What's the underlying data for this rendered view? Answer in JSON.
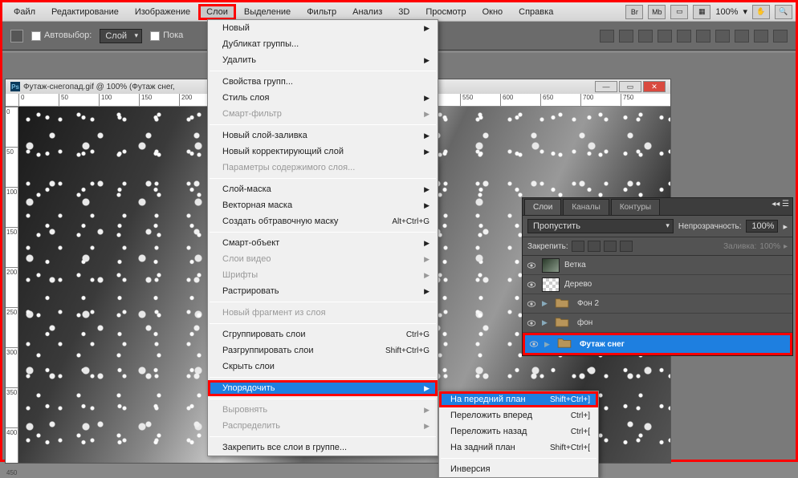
{
  "menubar": {
    "items": [
      "Файл",
      "Редактирование",
      "Изображение",
      "Слои",
      "Выделение",
      "Фильтр",
      "Анализ",
      "3D",
      "Просмотр",
      "Окно",
      "Справка"
    ],
    "highlighted": "Слои",
    "zoom": "100%"
  },
  "optbar": {
    "autoselect_label": "Автовыбор:",
    "autoselect_value": "Слой",
    "show_label": "Пока"
  },
  "doc": {
    "title": "Футаж-снегопад.gif @ 100% (Футаж снег,",
    "ruler_h": [
      "0",
      "50",
      "100",
      "150",
      "200",
      "550",
      "600",
      "650",
      "700",
      "750"
    ],
    "ruler_v": [
      "0",
      "50",
      "100",
      "150",
      "200",
      "250",
      "300",
      "350",
      "400",
      "450"
    ]
  },
  "dropdown": {
    "groups": [
      [
        {
          "label": "Новый",
          "arrow": true
        },
        {
          "label": "Дубликат группы..."
        },
        {
          "label": "Удалить",
          "arrow": true
        }
      ],
      [
        {
          "label": "Свойства групп..."
        },
        {
          "label": "Стиль слоя",
          "arrow": true
        },
        {
          "label": "Смарт-фильтр",
          "arrow": true,
          "disabled": true
        }
      ],
      [
        {
          "label": "Новый слой-заливка",
          "arrow": true
        },
        {
          "label": "Новый корректирующий слой",
          "arrow": true
        },
        {
          "label": "Параметры содержимого слоя...",
          "disabled": true
        }
      ],
      [
        {
          "label": "Слой-маска",
          "arrow": true
        },
        {
          "label": "Векторная маска",
          "arrow": true
        },
        {
          "label": "Создать обтравочную маску",
          "shortcut": "Alt+Ctrl+G"
        }
      ],
      [
        {
          "label": "Смарт-объект",
          "arrow": true
        },
        {
          "label": "Слои видео",
          "arrow": true,
          "disabled": true
        },
        {
          "label": "Шрифты",
          "arrow": true,
          "disabled": true
        },
        {
          "label": "Растрировать",
          "arrow": true
        }
      ],
      [
        {
          "label": "Новый фрагмент из слоя",
          "disabled": true
        }
      ],
      [
        {
          "label": "Сгруппировать слои",
          "shortcut": "Ctrl+G"
        },
        {
          "label": "Разгруппировать слои",
          "shortcut": "Shift+Ctrl+G"
        },
        {
          "label": "Скрыть слои"
        }
      ],
      [
        {
          "label": "Упорядочить",
          "arrow": true,
          "hl": true
        }
      ],
      [
        {
          "label": "Выровнять",
          "arrow": true,
          "disabled": true
        },
        {
          "label": "Распределить",
          "arrow": true,
          "disabled": true
        }
      ],
      [
        {
          "label": "Закрепить все слои в группе..."
        }
      ]
    ]
  },
  "submenu": {
    "items": [
      {
        "label": "На передний план",
        "shortcut": "Shift+Ctrl+]",
        "hl": true
      },
      {
        "label": "Переложить вперед",
        "shortcut": "Ctrl+]"
      },
      {
        "label": "Переложить назад",
        "shortcut": "Ctrl+["
      },
      {
        "label": "На задний план",
        "shortcut": "Shift+Ctrl+["
      }
    ],
    "items2": [
      {
        "label": "Инверсия"
      }
    ]
  },
  "layers_panel": {
    "tabs": [
      "Слои",
      "Каналы",
      "Контуры"
    ],
    "blend_mode": "Пропустить",
    "opacity_label": "Непрозрачность:",
    "opacity_value": "100%",
    "lock_label": "Закрепить:",
    "fill_label": "Заливка:",
    "fill_value": "100%",
    "layers": [
      {
        "name": "Ветка",
        "type": "image",
        "thumb": "photo"
      },
      {
        "name": "Дерево",
        "type": "image",
        "thumb": "checker"
      },
      {
        "name": "Фон 2",
        "type": "group",
        "expand": true
      },
      {
        "name": "фон",
        "type": "group",
        "expand": true
      },
      {
        "name": "Футаж снег",
        "type": "group",
        "expand": true,
        "selected": true
      }
    ]
  }
}
